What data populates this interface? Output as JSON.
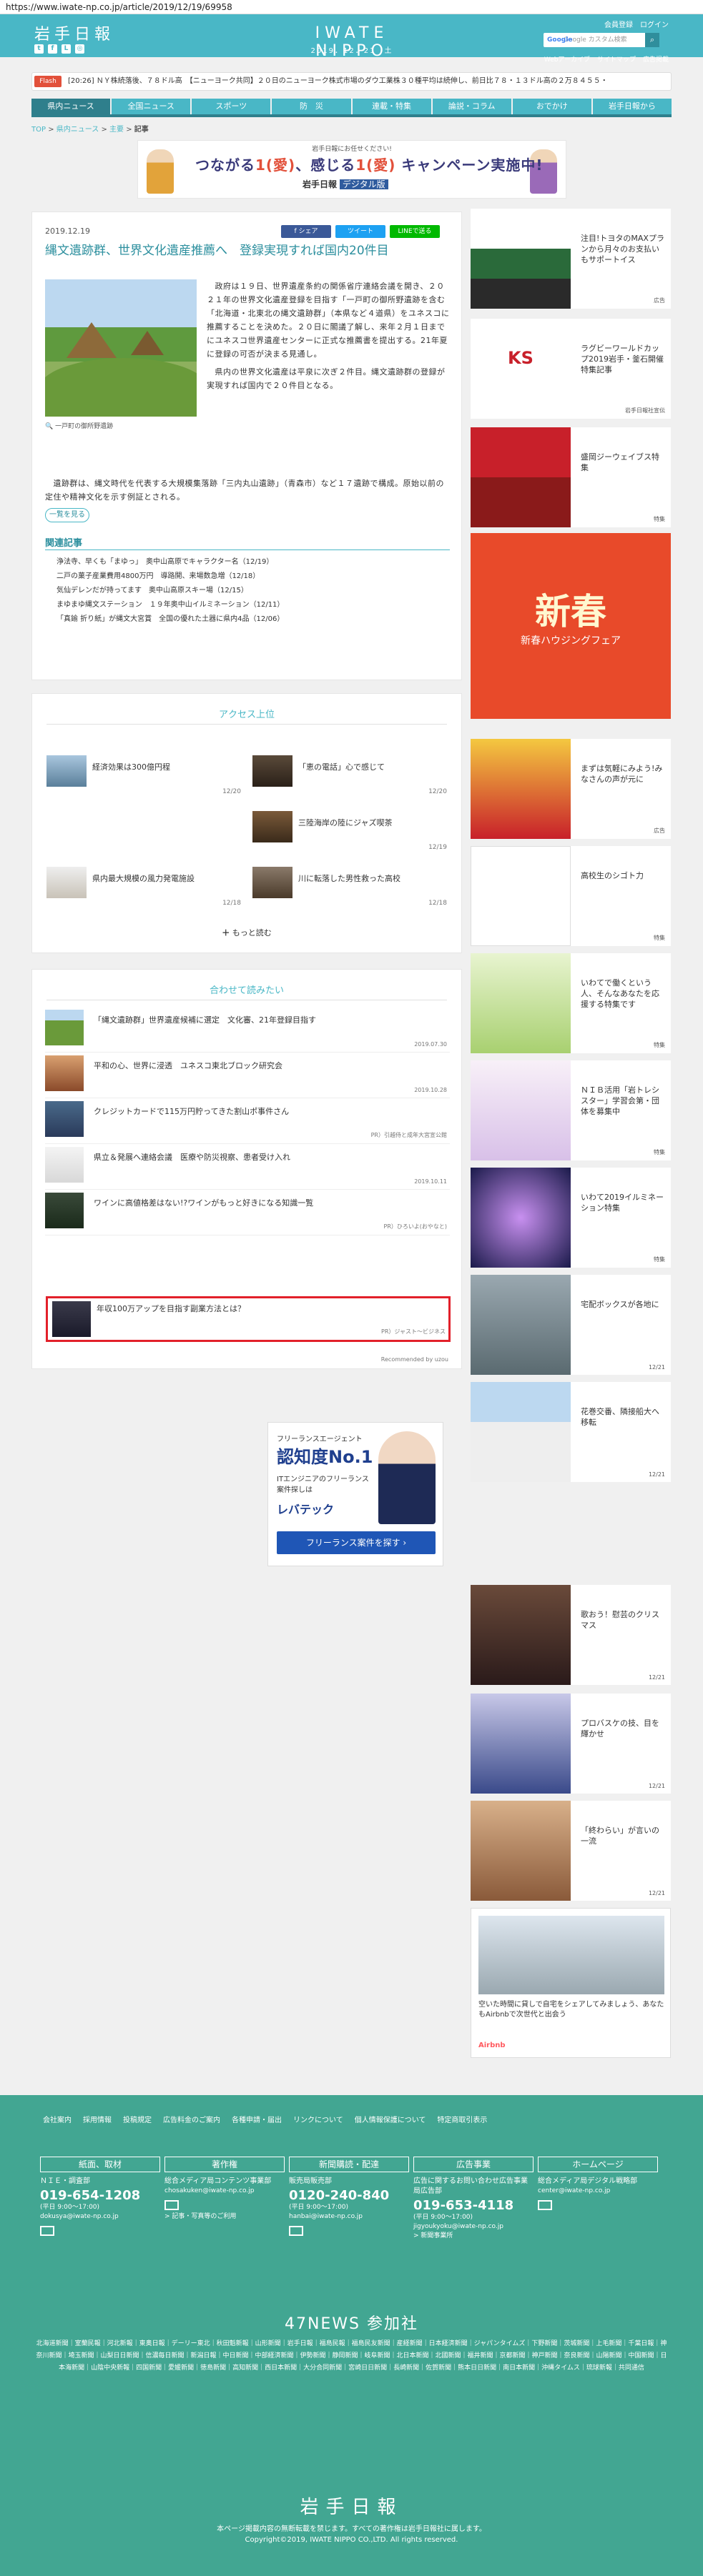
{
  "url": "https://www.iwate-np.co.jp/article/2019/12/19/69958",
  "header": {
    "logo": "岩手日報",
    "site_name": "IWATE NIPPO",
    "date_line": "2019．12．21　土",
    "links": [
      "会員登録",
      "ログイン"
    ],
    "sublinks": [
      "Webアーカイブ",
      "サイトマップ",
      "広告掲載"
    ],
    "search_placeholder": "Google カスタム検索",
    "search_brand": "Google",
    "social_icons": [
      "twitter-icon",
      "facebook-icon",
      "line-icon",
      "instagram-icon"
    ]
  },
  "flash": {
    "label": "Flash",
    "text": "[20:26] ＮＹ株続落後、７８ドル高　【ニューヨーク共同】２０日のニューヨーク株式市場のダウ工業株３０種平均は続伸し、前日比７８・１３ドル高の２万８４５５・"
  },
  "nav": [
    "県内ニュース",
    "全国ニュース",
    "スポーツ",
    "防　災",
    "連載・特集",
    "論説・コラム",
    "おでかけ",
    "岩手日報から"
  ],
  "breadcrumb": [
    "TOP",
    "県内ニュース",
    "主要",
    "記事"
  ],
  "campaign_banner": {
    "top": "岩手日報にお任せください!",
    "main_a": "つながる",
    "main_b": "1(愛)",
    "main_c": "、感じる",
    "main_d": "1(愛)",
    "main_e": " キャンペーン実施中!",
    "brand": "岩手日報",
    "brand_tag": "デジタル版"
  },
  "article": {
    "date": "2019.12.19",
    "share": [
      "f シェア",
      "ツイート",
      "LINEで送る"
    ],
    "title": "縄文遺跡群、世界文化遺産推薦へ　登録実現すれば国内20件目",
    "caption": "一戸町の御所野遺跡",
    "body1": "　政府は１９日、世界遺産条約の関係省庁連絡会議を開き、２０２１年の世界文化遺産登録を目指す「一戸町の御所野遺跡を含む「北海道・北東北の縄文遺跡群」（本県など４道県）をユネスコに推薦することを決めた。２０日に閣議了解し、来年２月１日までにユネスコ世界遺産センターに正式な推薦書を提出する。21年夏に登録の可否が決まる見通し。",
    "body2": "　県内の世界文化遺産は平泉に次ぎ２件目。縄文遺跡群の登録が実現すれば国内で２０件目となる。",
    "body3": "　遺跡群は、縄文時代を代表する大規模集落跡「三内丸山遺跡」（青森市）など１７遺跡で構成。原始以前の定住や精神文化を示す例証とされる。",
    "list_button": "一覧を見る",
    "related_title": "関連記事",
    "related": [
      "浄法寺、早くも「まゆっ」　奥中山高原でキャラクター名（12/19）",
      "二戸の菓子産業費用4800万円　導路開、来場数急増（12/18）",
      "気仙デレンだが持ってます　奥中山高原スキー場（12/15）",
      "まゆまゆ縄文ステーション　１９年奥中山イルミネーション（12/11）",
      "「真鍮 折り紙」が縄文大宮賞　全国の優れた土器に県内4品（12/06）"
    ]
  },
  "ranking": {
    "title": "アクセス上位",
    "items": [
      {
        "title": "経済効果は300億円程",
        "date": "12/20"
      },
      {
        "title": "「恵の電話」心で感じて",
        "date": "12/20"
      },
      {
        "title": "",
        "date": ""
      },
      {
        "title": "三陸海岸の陸にジャズ喫茶",
        "date": "12/19"
      },
      {
        "title": "県内最大規模の風力発電施設",
        "date": "12/18"
      },
      {
        "title": "川に転落した男性救った高校",
        "date": "12/18"
      }
    ],
    "more": "もっと読む"
  },
  "recommend": {
    "title": "合わせて読みたい",
    "items": [
      {
        "title": "「縄文遺跡群」世界遺産候補に選定　文化審、21年登録目指す",
        "source": "2019.07.30"
      },
      {
        "title": "平和の心、世界に浸透　ユネスコ東北ブロック研究会",
        "source": "2019.10.28"
      },
      {
        "title": "クレジットカードで115万円貯ってきた割山ポ事件さん",
        "source": "PR）引越侍と成年大宮宣公館"
      },
      {
        "title": "県立＆発展へ連絡会議　医療や防災視察、患者受け入れ",
        "source": "2019.10.11"
      },
      {
        "title": "ワインに高値格差はない!?ワインがもっと好きになる知識一覧",
        "source": "PR）ひろいよ(おやなと)"
      },
      {
        "title": "年収100万アップを目指す副業方法とは？",
        "source": "PR）ジャスト〜ビジネス"
      }
    ],
    "powered": "Recommended by uzou"
  },
  "center_ad": {
    "line1": "フリーランスエージェント",
    "line2": "認知度No.1",
    "line3": "ITエンジニアのフリーランス案件探しは",
    "brand": "レバテック",
    "button": "フリーランス案件を探す ›"
  },
  "sidebar": [
    {
      "title": "注目!トヨタのMAXプランから月々のお支払いもサポートイス",
      "tag": "広告"
    },
    {
      "title": "ラグビーワールドカップ2019岩手・釜石開催特集記事",
      "tag": "岩手日報社宣伝"
    },
    {
      "title": "盛岡ジーウェイブス特集",
      "tag": "特集"
    },
    {
      "title": "新春ハウジングフェア",
      "tag": ""
    },
    {
      "title": "まずは気軽にみよう!みなさんの声が元に",
      "tag": "広告"
    },
    {
      "title": "高校生のシゴト力",
      "tag": "特集"
    },
    {
      "title": "いわてで働くという人、そんなあなたを応援する特集です",
      "tag": "特集"
    },
    {
      "title": "ＮＩＢ活用「岩トレシスター」学習会第・団体を募集中",
      "tag": "特集"
    },
    {
      "title": "いわて2019イルミネーション特集",
      "tag": "特集"
    },
    {
      "title": "宅配ボックスが各地に",
      "tag": "12/21"
    },
    {
      "title": "花巻交番、隣接船大へ移転",
      "tag": "12/21"
    },
    {
      "title": "歌おう！慰芸のクリスマス",
      "tag": "12/21"
    },
    {
      "title": "プロバスケの技、目を輝かせ",
      "tag": "12/21"
    },
    {
      "title": "「終わらい」が言いの一流",
      "tag": "12/21"
    }
  ],
  "sidebar_ad": {
    "title": "空いた時間に貸しで自宅をシェアしてみましょう、あなたもAirbnbで次世代と出会う",
    "brand": "Airbnb"
  },
  "footer": {
    "links": [
      "会社案内",
      "採用情報",
      "投稿規定",
      "広告料金のご案内",
      "各種申請・届出",
      "リンクについて",
      "個人情報保護について",
      "特定商取引表示"
    ],
    "cols": [
      {
        "h": "紙面、取材",
        "s": "ＮＩＥ・調査部",
        "tel": "019-654-1208",
        "small": "(平日 9:00〜17:00)",
        "mail": "dokusya@iwate-np.co.jp"
      },
      {
        "h": "著作権",
        "s": "総合メディア局コンテンツ事業部",
        "tel": "",
        "small": "",
        "mail": "chosakuken@iwate-np.co.jp",
        "extra": "> 記事・写真等のご利用"
      },
      {
        "h": "新聞購読・配達",
        "s": "販売局販売部",
        "tel": "0120-240-840",
        "small": "(平日 9:00〜17:00)",
        "mail": "hanbai@iwate-np.co.jp"
      },
      {
        "h": "広告事業",
        "s": "広告に関するお問い合わせ広告事業局広告部",
        "tel": "019-653-4118",
        "small": "(平日 9:00〜17:00)",
        "mail": "jigyoukyoku@iwate-np.co.jp",
        "extra": "> 新聞事業所"
      },
      {
        "h": "ホームページ",
        "s": "総合メディア局デジタル戦略部",
        "tel": "",
        "small": "",
        "mail": "center@iwate-np.co.jp"
      }
    ],
    "news47": "47NEWS 参加社",
    "papers": "北海道新聞｜室蘭民報｜河北新報｜東奥日報｜デーリー東北｜秋田魁新報｜山形新聞｜岩手日報｜福島民報｜福島民友新聞｜産経新聞｜日本経済新聞｜ジャパンタイムズ｜下野新聞｜茨城新聞｜上毛新聞｜千葉日報｜神奈川新聞｜埼玉新聞｜山梨日日新聞｜信濃毎日新聞｜新潟日報｜中日新聞｜中部経済新聞｜伊勢新聞｜静岡新聞｜岐阜新聞｜北日本新聞｜北國新聞｜福井新聞｜京都新聞｜神戸新聞｜奈良新聞｜山陽新聞｜中国新聞｜日本海新聞｜山陰中央新報｜四国新聞｜愛媛新聞｜徳島新聞｜高知新聞｜西日本新聞｜大分合同新聞｜宮崎日日新聞｜長崎新聞｜佐賀新聞｜熊本日日新聞｜南日本新聞｜沖縄タイムス｜琉球新報｜共同通信",
    "logo": "岩手日報",
    "copy1": "本ページ掲載内容の無断転載を禁じます。すべての著作権は岩手日報社に属します。",
    "copy2": "Copyright©2019, IWATE NIPPO CO.,LTD. All rights reserved."
  }
}
